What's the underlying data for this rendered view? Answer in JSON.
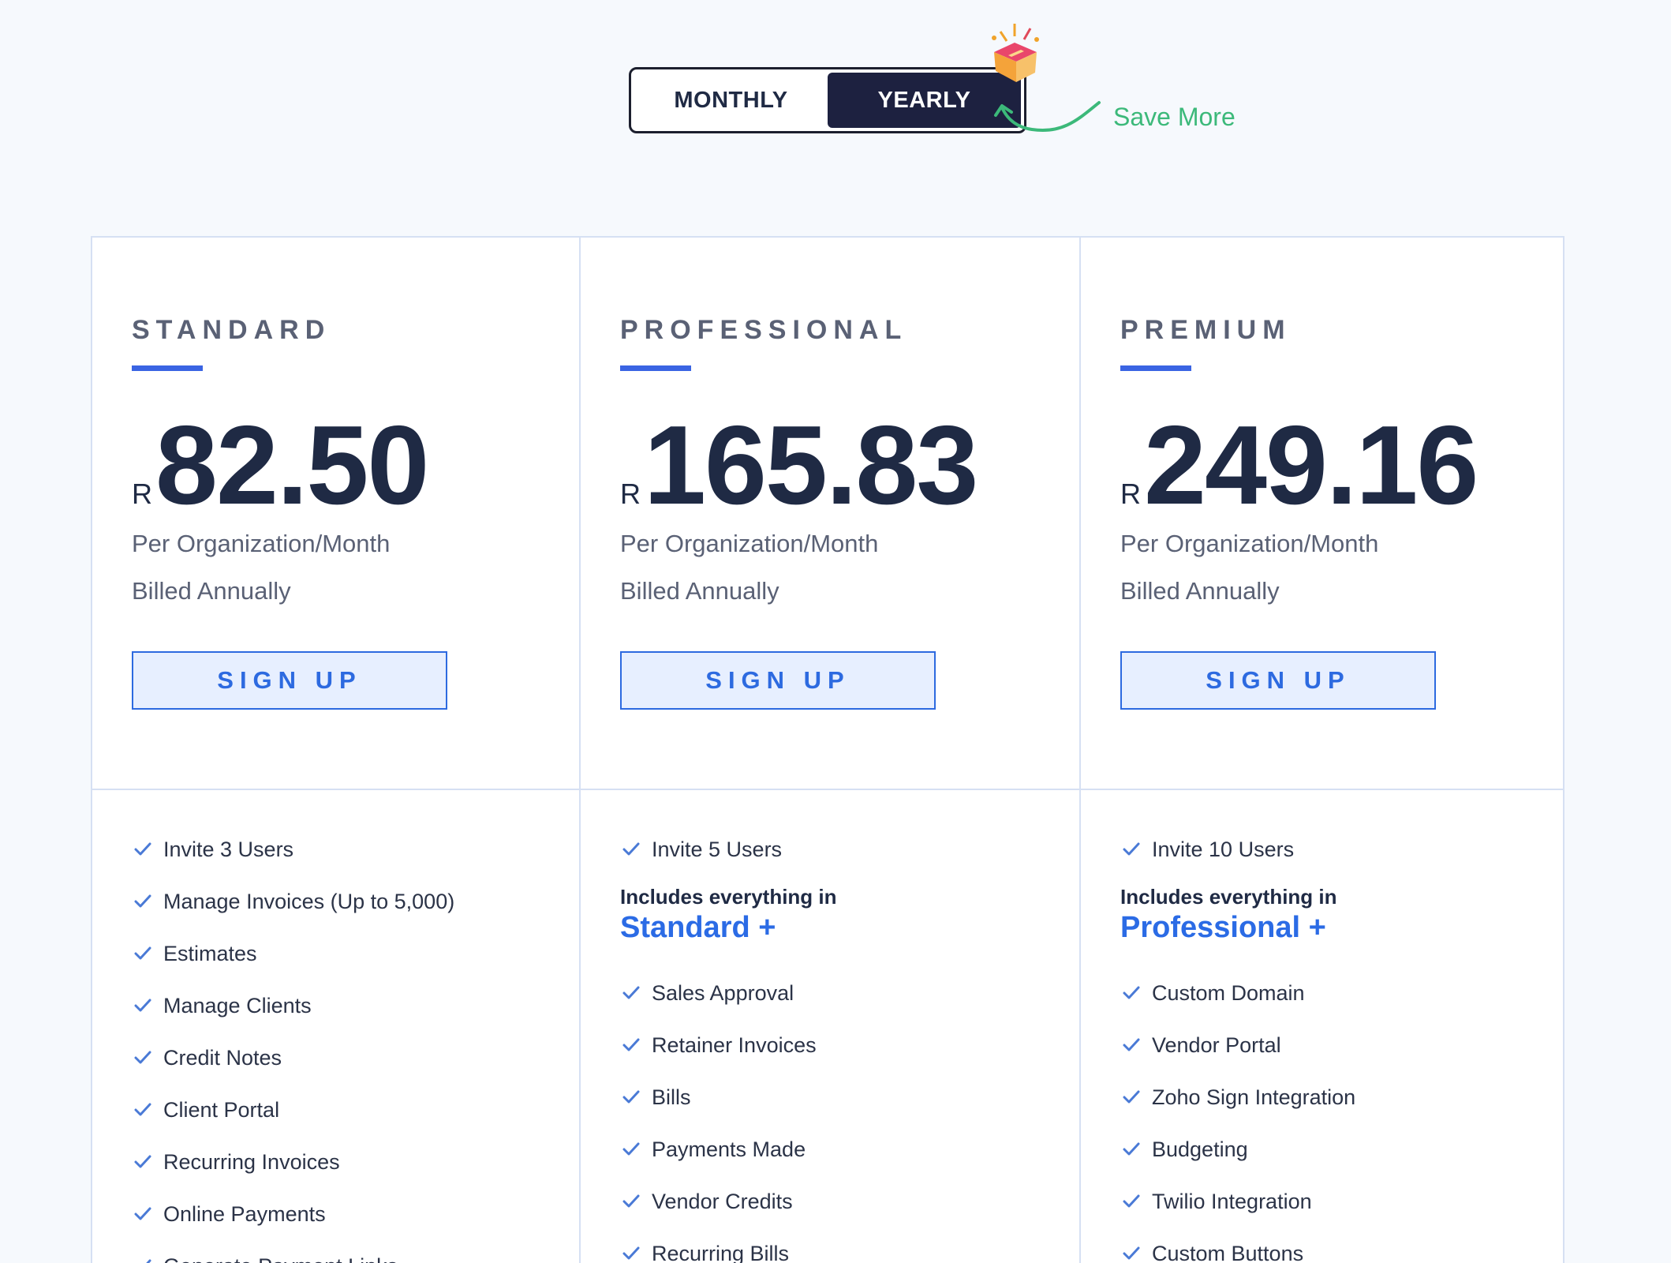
{
  "billing": {
    "monthly_label": "MONTHLY",
    "yearly_label": "YEARLY",
    "selected": "YEARLY",
    "save_more": "Save More"
  },
  "plans": [
    {
      "name": "STANDARD",
      "currency": "R",
      "price": "82.50",
      "per": "Per Organization/Month",
      "billed": "Billed Annually",
      "signup_label": "SIGN UP",
      "features": [
        "Invite 3 Users",
        "Manage Invoices (Up to 5,000)",
        "Estimates",
        "Manage Clients",
        "Credit Notes",
        "Client Portal",
        "Recurring Invoices",
        "Online Payments",
        "Generate Payment Links"
      ]
    },
    {
      "name": "PROFESSIONAL",
      "currency": "R",
      "price": "165.83",
      "per": "Per Organization/Month",
      "billed": "Billed Annually",
      "signup_label": "SIGN UP",
      "first_feature": "Invite 5 Users",
      "includes_line": "Includes everything in",
      "includes_plan": "Standard +",
      "features": [
        "Sales Approval",
        "Retainer Invoices",
        "Bills",
        "Payments Made",
        "Vendor Credits",
        "Recurring Bills"
      ]
    },
    {
      "name": "PREMIUM",
      "currency": "R",
      "price": "249.16",
      "per": "Per Organization/Month",
      "billed": "Billed Annually",
      "signup_label": "SIGN UP",
      "first_feature": "Invite 10 Users",
      "includes_line": "Includes everything in",
      "includes_plan": "Professional +",
      "features": [
        "Custom Domain",
        "Vendor Portal",
        "Zoho Sign Integration",
        "Budgeting",
        "Twilio Integration",
        "Custom Buttons"
      ]
    }
  ],
  "colors": {
    "accent": "#2d6ae0",
    "dark": "#1d2140",
    "save_green": "#3cb97a",
    "check": "#4a7ad6"
  },
  "icons": {
    "gift": "gift-box-icon",
    "arrow": "curved-arrow-icon",
    "check": "check-icon"
  }
}
